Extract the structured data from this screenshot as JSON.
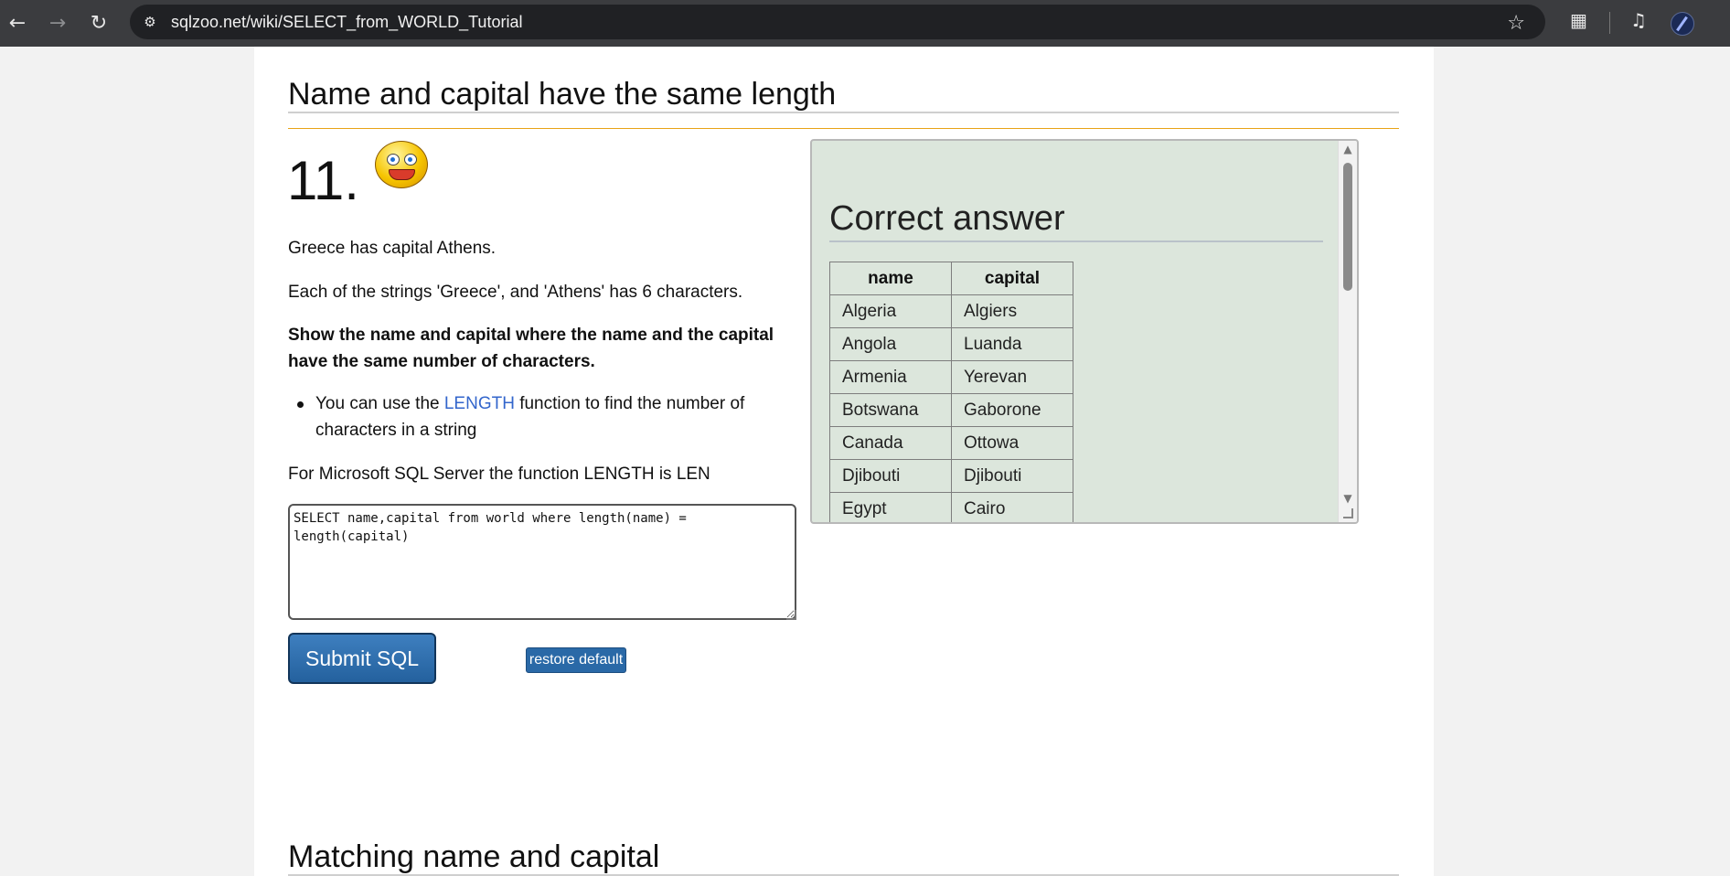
{
  "browser": {
    "url": "sqlzoo.net/wiki/SELECT_from_WORLD_Tutorial",
    "icons": [
      "back-arrow-icon",
      "forward-arrow-icon",
      "reload-icon",
      "site-info-icon",
      "star-icon",
      "extensions-icon",
      "media-icon",
      "profile-avatar-icon"
    ]
  },
  "section": {
    "heading": "Name and capital have the same length",
    "number": "11.",
    "paragraph1": "Greece has capital Athens.",
    "paragraph2": "Each of the strings 'Greece', and 'Athens' has 6 characters.",
    "task_line1": "Show the name and capital where the name and the capital",
    "task_line2": "have the same number of characters.",
    "bullet_prefix": "You can use the ",
    "bullet_link": "LENGTH",
    "bullet_suffix_line1": " function to find the number of",
    "bullet_line2": "characters in a string",
    "note": "For Microsoft SQL Server the function LENGTH is LEN"
  },
  "editor": {
    "sql_line1": "SELECT name,capital from world where length(name) =",
    "sql_line2": "length(capital)"
  },
  "buttons": {
    "submit": "Submit SQL",
    "restore": "restore default"
  },
  "answer": {
    "title": "Correct answer",
    "columns": [
      "name",
      "capital"
    ],
    "rows": [
      [
        "Algeria",
        "Algiers"
      ],
      [
        "Angola",
        "Luanda"
      ],
      [
        "Armenia",
        "Yerevan"
      ],
      [
        "Botswana",
        "Gaborone"
      ],
      [
        "Canada",
        "Ottowa"
      ],
      [
        "Djibouti",
        "Djibouti"
      ],
      [
        "Egypt",
        "Cairo"
      ]
    ]
  },
  "next_section": {
    "heading": "Matching name and capital"
  }
}
